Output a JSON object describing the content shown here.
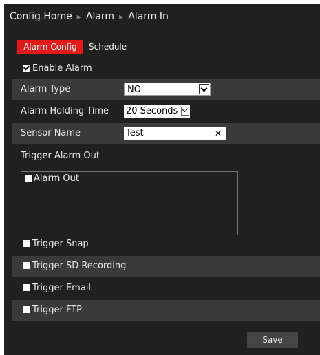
{
  "breadcrumb": [
    "Config Home",
    "Alarm",
    "Alarm In"
  ],
  "tabs": {
    "active": "Alarm Config",
    "other": "Schedule"
  },
  "enable_alarm": {
    "label": "Enable Alarm",
    "checked": true
  },
  "alarm_type": {
    "label": "Alarm Type",
    "value": "NO"
  },
  "holding_time": {
    "label": "Alarm Holding Time",
    "value": "20 Seconds"
  },
  "sensor_name": {
    "label": "Sensor Name",
    "value": "Test"
  },
  "trigger_alarm_out": {
    "label": "Trigger Alarm Out",
    "items": [
      {
        "label": "Alarm Out",
        "checked": false
      }
    ]
  },
  "triggers": [
    {
      "label": "Trigger Snap",
      "checked": false
    },
    {
      "label": "Trigger SD Recording",
      "checked": false
    },
    {
      "label": "Trigger Email",
      "checked": false
    },
    {
      "label": "Trigger FTP",
      "checked": false
    }
  ],
  "save_label": "Save",
  "colors": {
    "accent": "#e21a1a",
    "background": "#202020",
    "alt_row": "#3a3a3a"
  },
  "icons": {
    "breadcrumb_separator": "triangle-right-icon",
    "clear": "close-icon",
    "dropdown": "chevron-down-icon"
  }
}
